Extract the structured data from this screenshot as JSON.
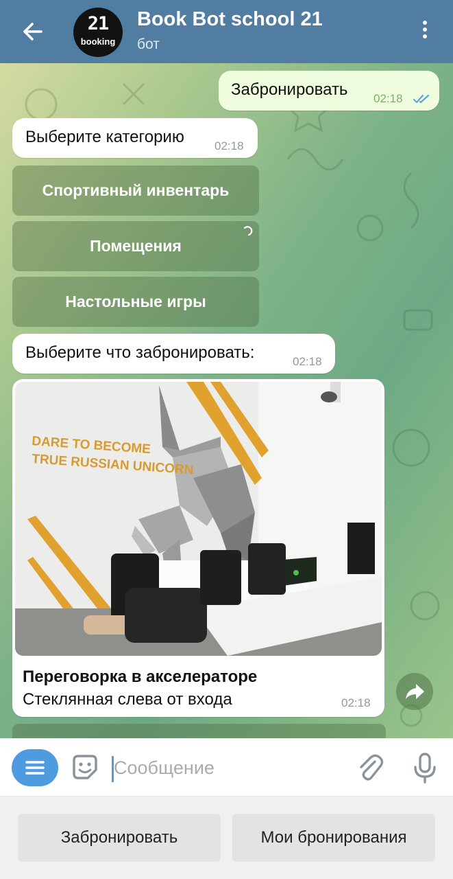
{
  "header": {
    "title": "Book Bot school 21",
    "subtitle": "бот",
    "avatar_mark": "21",
    "avatar_label": "booking",
    "back_icon": "arrow-left-icon",
    "menu_icon": "more-vertical-icon",
    "background": "#517da2"
  },
  "messages": [
    {
      "type": "outgoing",
      "text": "Забронировать",
      "time": "02:18",
      "status": "read"
    },
    {
      "type": "incoming",
      "text": "Выберите категорию",
      "time": "02:18"
    },
    {
      "type": "incoming",
      "text": "Выберите что забронировать:",
      "time": "02:18"
    }
  ],
  "inline_buttons": [
    {
      "label": "Спортивный инвентарь"
    },
    {
      "label": "Помещения",
      "loading": true
    },
    {
      "label": "Настольные игры"
    }
  ],
  "photo_message": {
    "wall_text_line1": "DARE TO BECOME",
    "wall_text_line2": "TRUE RUSSIAN UNICORN",
    "caption_title": "Переговорка в акселераторе",
    "caption_text": "Стеклянная слева от входа",
    "time": "02:18"
  },
  "input": {
    "placeholder": "Сообщение",
    "value": ""
  },
  "reply_keyboard": [
    {
      "label": "Забронировать"
    },
    {
      "label": "Мои бронирования"
    }
  ],
  "colors": {
    "accent": "#4e9be0",
    "outgoing_bubble": "#effdde",
    "incoming_bubble": "#ffffff"
  }
}
